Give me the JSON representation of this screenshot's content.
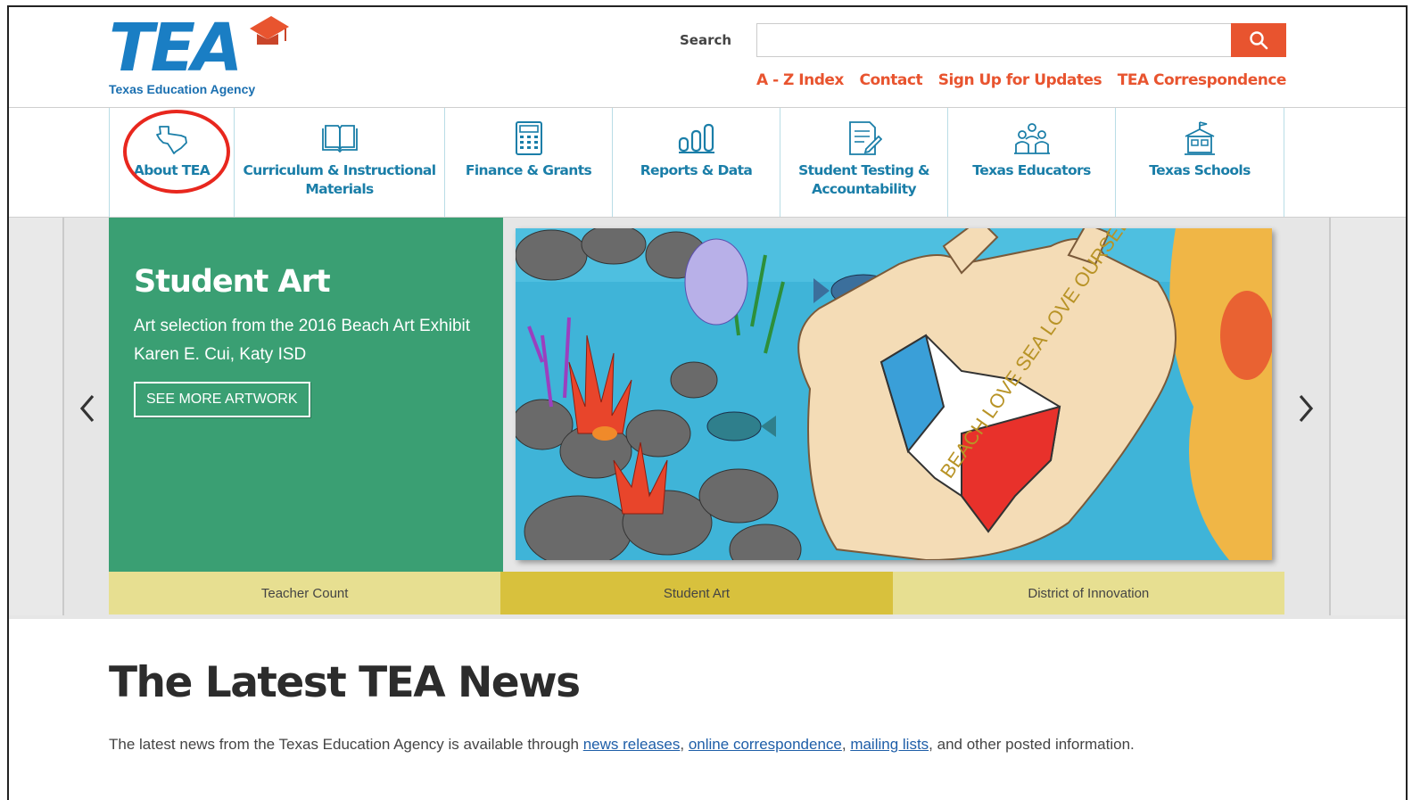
{
  "header": {
    "logo_text": "TEA",
    "logo_subtitle": "Texas Education Agency",
    "search_label": "Search",
    "search_value": "",
    "util_links": [
      "A - Z Index",
      "Contact",
      "Sign Up for Updates",
      "TEA Correspondence"
    ]
  },
  "nav": {
    "items": [
      {
        "label": "About TEA",
        "icon": "texas-map-icon"
      },
      {
        "label": "Curriculum & Instructional Materials",
        "icon": "open-book-icon"
      },
      {
        "label": "Finance & Grants",
        "icon": "calculator-icon"
      },
      {
        "label": "Reports & Data",
        "icon": "bar-chart-icon"
      },
      {
        "label": "Student Testing & Accountability",
        "icon": "test-paper-icon"
      },
      {
        "label": "Texas Educators",
        "icon": "educators-group-icon"
      },
      {
        "label": "Texas Schools",
        "icon": "school-building-icon"
      }
    ]
  },
  "carousel": {
    "title": "Student Art",
    "description_line1": "Art selection from the 2016 Beach Art Exhibit",
    "description_line2": "Karen E. Cui, Katy ISD",
    "button_label": "SEE MORE ARTWORK",
    "art_text": "BEACH LOVE SEA LOVE OURSELVES!",
    "tabs": [
      "Teacher Count",
      "Student Art",
      "District of Innovation"
    ],
    "active_tab": 1
  },
  "news": {
    "title": "The Latest TEA News",
    "intro_start": "The latest news from the Texas Education Agency is available through ",
    "link1": "news releases",
    "sep1": ", ",
    "link2": "online correspondence",
    "sep2": ", ",
    "link3": "mailing lists",
    "intro_end": ", and other posted information."
  },
  "colors": {
    "brand_blue": "#1a7ec4",
    "accent_orange": "#e8542f",
    "nav_text": "#1a7ea8",
    "slide_green": "#3a9f73",
    "tab_bg": "#e7df91",
    "tab_active": "#d8c13d",
    "highlight_ring": "#e8271e"
  }
}
